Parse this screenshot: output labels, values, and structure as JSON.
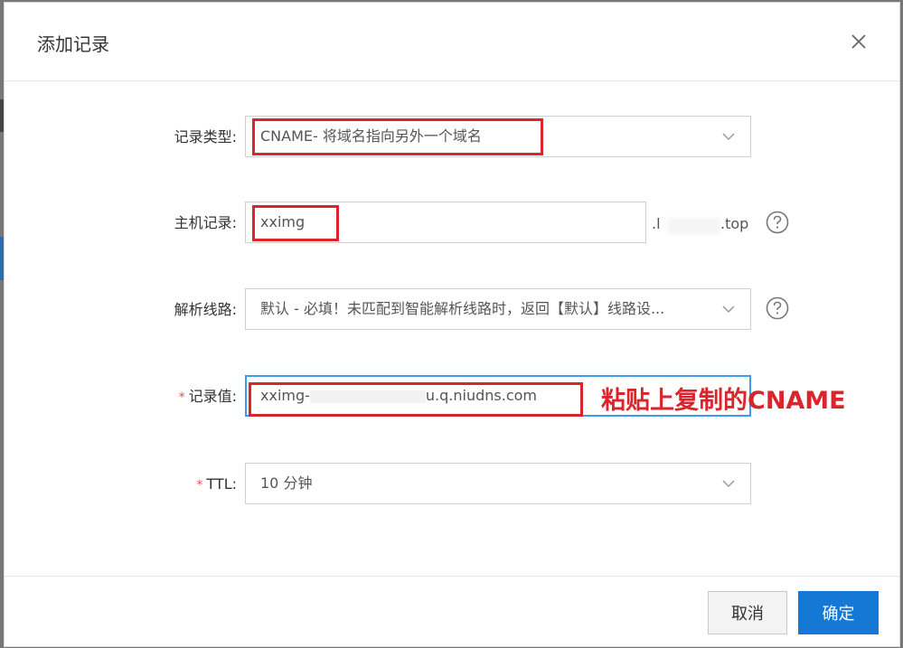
{
  "dialog": {
    "title": "添加记录",
    "close_icon": "close-icon"
  },
  "form": {
    "record_type": {
      "label": "记录类型:",
      "value": "CNAME- 将域名指向另外一个域名"
    },
    "host_record": {
      "label": "主机记录:",
      "value": "xximg",
      "suffix_prefix": ".l",
      "suffix_end": ".top",
      "help_icon": "question-circle-icon"
    },
    "line": {
      "label": "解析线路:",
      "value": "默认 - 必填！未匹配到智能解析线路时，返回【默认】线路设...",
      "help_icon": "question-circle-icon"
    },
    "record_value": {
      "required_mark": "*",
      "label": "记录值:",
      "value_start": "xximg-",
      "value_end": "u.q.niudns.com"
    },
    "ttl": {
      "required_mark": "*",
      "label": "TTL:",
      "value": "10 分钟"
    }
  },
  "annotation": {
    "text": "粘贴上复制的CNAME",
    "color": "#d9262c"
  },
  "footer": {
    "cancel_label": "取消",
    "ok_label": "确定"
  },
  "colors": {
    "primary": "#1478d4",
    "highlight": "#d9262c"
  }
}
